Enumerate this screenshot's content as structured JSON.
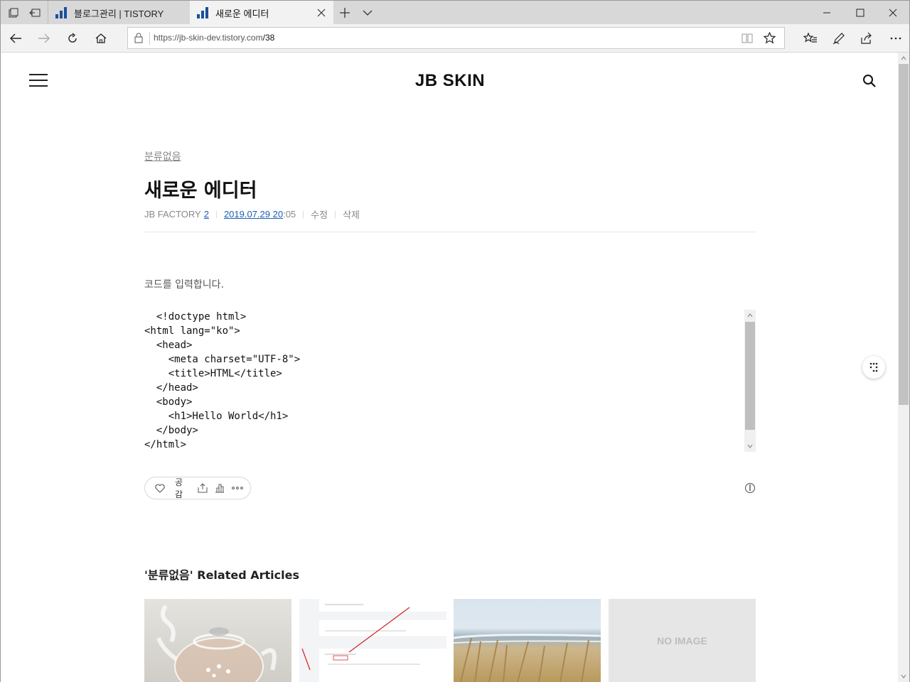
{
  "browser": {
    "tabs": [
      {
        "label": "블로그관리 | TISTORY"
      },
      {
        "label": "새로운 에디터"
      }
    ],
    "address": {
      "host": "https://jb-skin-dev.tistory.com",
      "path": "/38"
    }
  },
  "site": {
    "title": "JB SKIN"
  },
  "post": {
    "category": "분류없음",
    "title": "새로운 에디터",
    "author": "JB FACTORY",
    "comment_count": "2",
    "date": "2019.07.29 20",
    "time": ":05",
    "edit_label": "수정",
    "delete_label": "삭제",
    "intro": "코드를 입력합니다.",
    "code": "  <!doctype html>\n<html lang=\"ko\">\n  <head>\n    <meta charset=\"UTF-8\">\n    <title>HTML</title>\n  </head>\n  <body>\n    <h1>Hello World</h1>\n  </body>\n</html>",
    "like_label": "공감"
  },
  "related": {
    "category": "'분류없음'",
    "heading": " Related Articles",
    "no_image_label": "NO IMAGE"
  },
  "colors": {
    "link": "#1a5fb4",
    "favicon": "#1a4f9c"
  }
}
